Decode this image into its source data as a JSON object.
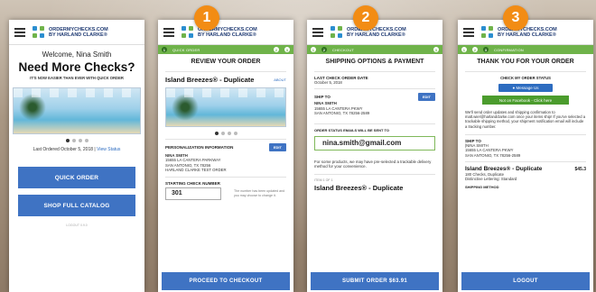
{
  "steps": [
    "1",
    "2",
    "3"
  ],
  "brand": {
    "line1": "ORDERMYCHECKS.COM",
    "line2": "BY HARLAND CLARKE®"
  },
  "screen1": {
    "welcome": "Welcome, Nina Smith",
    "headline": "Need More Checks?",
    "subhead": "IT'S NOW EASIER THAN EVER WITH QUICK ORDER",
    "last_ordered": "Last Ordered October 5, 2018 |",
    "view_status": "View Status",
    "quick_order": "QUICK ORDER",
    "shop_catalog": "SHOP FULL CATALOG",
    "version": "LOGOUT 0.9.0"
  },
  "screen2": {
    "progress": [
      "1",
      "QUICK ORDER",
      "2",
      "3"
    ],
    "title": "REVIEW YOUR ORDER",
    "product": "Island Breezes® - Duplicate",
    "about": "ABOUT",
    "personalization_label": "PERSONALIZATION INFORMATION",
    "edit": "EDIT",
    "name": "NINA SMITH",
    "addr1": "15655 LA CANTERA PARKWAY",
    "addr2": "SAN ANTONIO, TX 78256",
    "addr3": "HARLAND CLARKE TEST ORDER",
    "starting_label": "STARTING CHECK NUMBER",
    "starting_value": "301",
    "starting_note": "The number has been updated and you may choose to change it.",
    "cta": "PROCEED TO CHECKOUT"
  },
  "screen3": {
    "progress": [
      "1",
      "2",
      "CHECKOUT",
      "3"
    ],
    "title": "SHIPPING OPTIONS & PAYMENT",
    "last_date_label": "LAST CHECK ORDER DATE",
    "last_date": "October 5, 2018",
    "ship_to_label": "SHIP TO",
    "edit": "EDIT",
    "name": "NINA SMITH",
    "addr1": "15655 LA CANTERA PKWY",
    "addr2": "SAN ANTONIO, TX 78256-2589",
    "email_label": "ORDER STATUS EMAILS WILL BE SENT TO",
    "email": "nina.smith@gmail.com",
    "note": "For some products, we may have pre-selected a trackable delivery method for your convenience.",
    "item_label": "ITEM 1 OF 1",
    "product": "Island Breezes® - Duplicate",
    "cta": "SUBMIT ORDER   $63.91"
  },
  "screen4": {
    "progress": [
      "1",
      "2",
      "3",
      "CONFIRMATION"
    ],
    "title": "THANK YOU FOR YOUR ORDER",
    "check_status": "CHECK MY ORDER STATUS",
    "message_us": "Message Us",
    "facebook": "Not on Facebook - Click here",
    "body": "We'll send order updates and shipping confirmation to matt.wier@harlandclarke.com once your items ship! If you've selected a trackable shipping method, your shipment notification email will include a tracking number.",
    "ship_to_label": "SHIP TO",
    "name": "|NINA SMITH",
    "addr1": "15655 LA CANTERA PKWY",
    "addr2": "SAN ANTONIO, TX 78256-2589",
    "product": "Island Breezes® - Duplicate",
    "price": "$45.3",
    "qty": "180 Checks, Duplicate",
    "lettering": "Distinctive Lettering: Standard",
    "shipping_label": "SHIPPING METHOD",
    "cta": "LOGOUT"
  }
}
